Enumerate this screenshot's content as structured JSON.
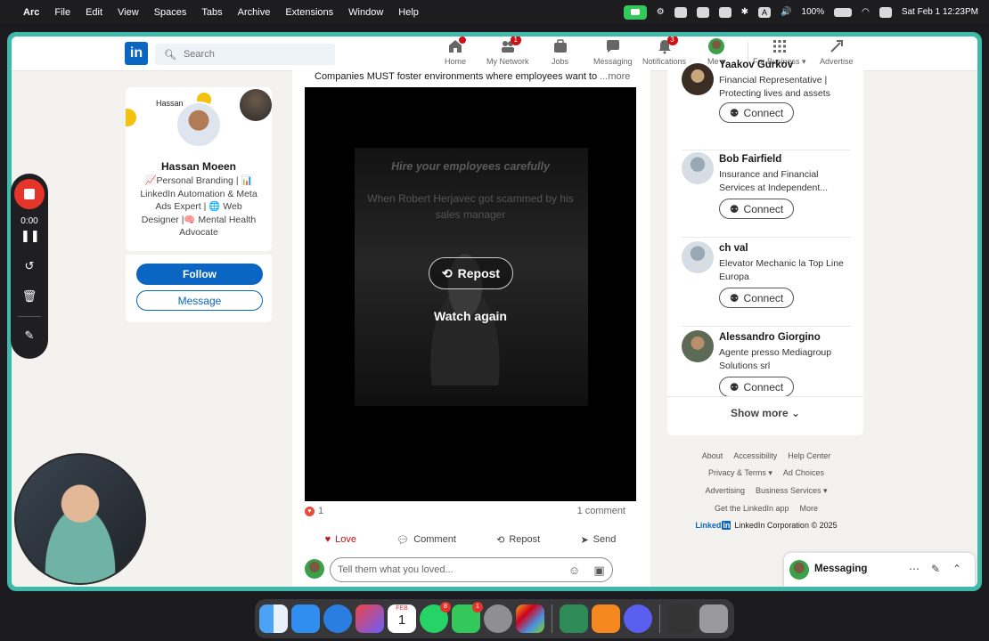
{
  "menubar": {
    "app": "Arc",
    "items": [
      "File",
      "Edit",
      "View",
      "Spaces",
      "Tabs",
      "Archive",
      "Extensions",
      "Window",
      "Help"
    ],
    "battery": "100%",
    "datetime": "Sat Feb 1  12:23PM"
  },
  "nav": {
    "logo": "in",
    "search_placeholder": "Search",
    "items": [
      {
        "label": "Home",
        "badge": ""
      },
      {
        "label": "My Network",
        "badge": "1"
      },
      {
        "label": "Jobs",
        "badge": ""
      },
      {
        "label": "Messaging",
        "badge": ""
      },
      {
        "label": "Notifications",
        "badge": "3"
      },
      {
        "label": "Me ▾",
        "badge": ""
      },
      {
        "label": "For Business ▾",
        "badge": ""
      },
      {
        "label": "Advertise",
        "badge": ""
      }
    ]
  },
  "profile": {
    "banner_text": "Hassan",
    "name": "Hassan Moeen",
    "headline": "📈Personal Branding | 📊 LinkedIn Automation & Meta Ads Expert | 🌐 Web Designer |🧠 Mental Health Advocate",
    "follow_label": "Follow",
    "message_label": "Message"
  },
  "recorder": {
    "time": "0:00"
  },
  "post": {
    "text": "Companies MUST foster environments where employees want to",
    "more": "...more",
    "video_title": "Hire your employees carefully",
    "video_subtitle": "When Robert Herjavec got scammed by his sales manager",
    "repost_overlay": "Repost",
    "watch_again": "Watch again",
    "reaction_count": "1",
    "comment_count": "1 comment",
    "actions": [
      "Love",
      "Comment",
      "Repost",
      "Send"
    ],
    "comment_placeholder": "Tell them what you loved..."
  },
  "suggestions": [
    {
      "name": "Yaakov Gurkov",
      "headline": "Financial Representative | Protecting lives and assets",
      "button": "Connect"
    },
    {
      "name": "Bob Fairfield",
      "headline": "Insurance and Financial Services at Independent...",
      "button": "Connect"
    },
    {
      "name": "ch val",
      "headline": "Elevator Mechanic la Top Line Europa",
      "button": "Connect"
    },
    {
      "name": "Alessandro Giorgino",
      "headline": "Agente presso Mediagroup Solutions srl",
      "button": "Connect"
    }
  ],
  "show_more": "Show more ⌄",
  "footer": {
    "links_row1": [
      "About",
      "Accessibility",
      "Help Center"
    ],
    "links_row2": [
      "Privacy & Terms ▾",
      "Ad Choices"
    ],
    "links_row3": [
      "Advertising",
      "Business Services ▾"
    ],
    "links_row4": [
      "Get the LinkedIn app",
      "More"
    ],
    "brand_word": "Linked",
    "brand_in": "in",
    "copyright": "LinkedIn Corporation © 2025"
  },
  "messaging": {
    "label": "Messaging"
  },
  "dock": {
    "calendar_month": "FEB",
    "calendar_day": "1",
    "whatsapp_badge": "8",
    "messages_badge": "1"
  },
  "colors": {
    "linkedin_blue": "#0a66c2",
    "window_frame": "#3fb9a9",
    "record_red": "#e5352b"
  }
}
